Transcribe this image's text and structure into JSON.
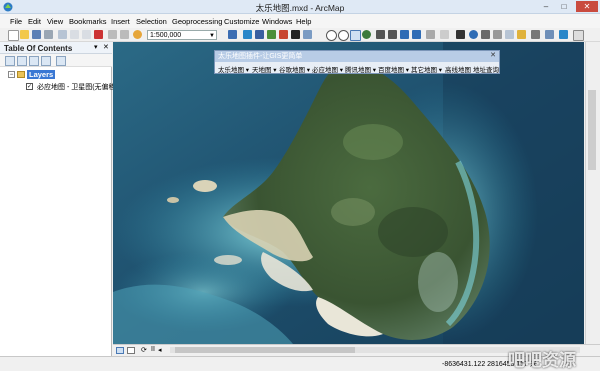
{
  "window": {
    "title": "太乐地图.mxd - ArcMap",
    "controls": [
      "–",
      "□",
      "✕"
    ]
  },
  "menu": [
    "File",
    "Edit",
    "View",
    "Bookmarks",
    "Insert",
    "Selection",
    "Geoprocessing",
    "Customize",
    "Windows",
    "Help"
  ],
  "toolbar": {
    "scale": "1:500,000"
  },
  "toc": {
    "title": "Table Of Contents",
    "pin": "▾",
    "close": "✕",
    "root_label": "Layers",
    "layer_name": "必应地图 - 卫星图(无偏移)",
    "layer_checked": "✓"
  },
  "plugin": {
    "title": "太乐地图插件-让GIS更简单",
    "close": "✕",
    "buttons": [
      "太乐地图 ▾",
      "天地图 ▾",
      "谷歌地图 ▾",
      "必应地图 ▾",
      "腾讯地图 ▾",
      "百度地图 ▾",
      "其它地图 ▾",
      "高线地图",
      "地址查询"
    ]
  },
  "status": {
    "coordinates": "-8636431.122  2816453.157 米",
    "watermark": "吧吧资源"
  },
  "colors": {
    "sea_deep": "#1f4f6f",
    "sea_shallow": "#5fc6d6",
    "land_forest": "#3f5a35",
    "sand": "#e9e6d8",
    "selection": "#3a78d4"
  }
}
